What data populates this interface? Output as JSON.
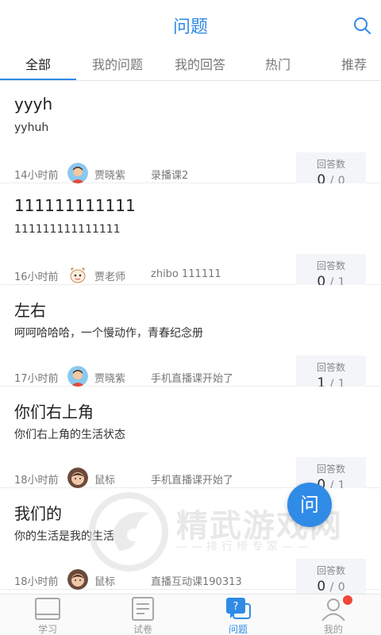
{
  "header": {
    "title": "问题",
    "search_icon": "search-icon"
  },
  "tabs": [
    {
      "label": "全部",
      "active": true
    },
    {
      "label": "我的问题",
      "active": false
    },
    {
      "label": "我的回答",
      "active": false
    },
    {
      "label": "热门",
      "active": false
    },
    {
      "label": "推荐",
      "active": false
    }
  ],
  "answer_label": "回答数",
  "questions": [
    {
      "title": "yyyh",
      "desc": "yyhuh",
      "time": "14小时前",
      "author": "贾晓紫",
      "avatar": "avatar-boy",
      "course": "录播课2",
      "answered": "0",
      "sep": "/",
      "total": "0"
    },
    {
      "title": "111111111111",
      "desc": "111111111111111",
      "time": "16小时前",
      "author": "贾老师",
      "avatar": "avatar-cartoon",
      "course": "zhibo 111111",
      "answered": "0",
      "sep": "/",
      "total": "1"
    },
    {
      "title": "左右",
      "desc": "呵呵哈哈哈，一个慢动作，青春纪念册",
      "time": "17小时前",
      "author": "贾晓紫",
      "avatar": "avatar-boy",
      "course": "手机直播课开始了",
      "answered": "1",
      "sep": "/",
      "total": "1"
    },
    {
      "title": "你们右上角",
      "desc": "你们右上角的生活状态",
      "time": "18小时前",
      "author": "鼠标",
      "avatar": "avatar-baby",
      "course": "手机直播课开始了",
      "answered": "0",
      "sep": "/",
      "total": "1"
    },
    {
      "title": "我们的",
      "desc": "你的生活是我的生活",
      "time": "18小时前",
      "author": "鼠标",
      "avatar": "avatar-baby",
      "course": "直播互动课190313",
      "answered": "0",
      "sep": "/",
      "total": "0"
    }
  ],
  "fab": {
    "label": "问"
  },
  "watermark": {
    "text": "精武游戏网",
    "sub": "——排行榜专家——"
  },
  "bottom_nav": [
    {
      "label": "学习",
      "icon": "book-icon",
      "active": false
    },
    {
      "label": "试卷",
      "icon": "paper-icon",
      "active": false
    },
    {
      "label": "问题",
      "icon": "question-chat-icon",
      "active": true
    },
    {
      "label": "我的",
      "icon": "user-icon",
      "active": false,
      "badge": true
    }
  ],
  "colors": {
    "accent": "#2f8be6",
    "badge": "#f0473a",
    "answer_box": "#f3f5f8"
  }
}
